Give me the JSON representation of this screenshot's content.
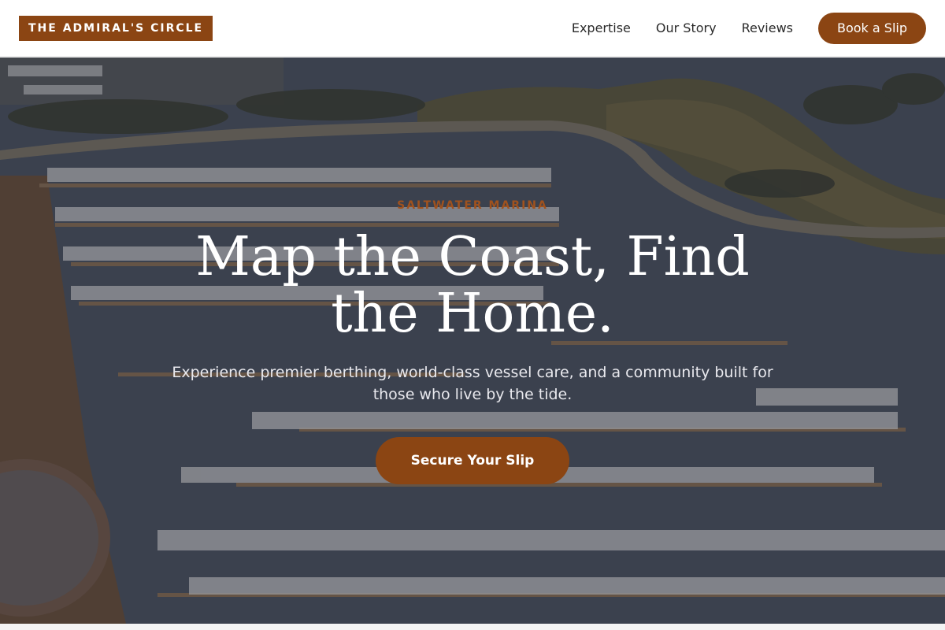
{
  "brand": {
    "name": "THE ADMIRAL'S CIRCLE"
  },
  "nav": {
    "links": [
      "Expertise",
      "Our Story",
      "Reviews"
    ],
    "cta_label": "Book a Slip"
  },
  "hero": {
    "eyebrow": "SALTWATER MARINA",
    "title": "Map the Coast, Find the Home.",
    "subtitle": "Experience premier berthing, world-class vessel care, and a community built for those who live by the tide.",
    "cta_label": "Secure Your Slip"
  },
  "colors": {
    "accent": "#8b4513",
    "header_bg": "#ffffff",
    "nav_text": "#2a2a2a",
    "hero_text": "#ffffff"
  }
}
